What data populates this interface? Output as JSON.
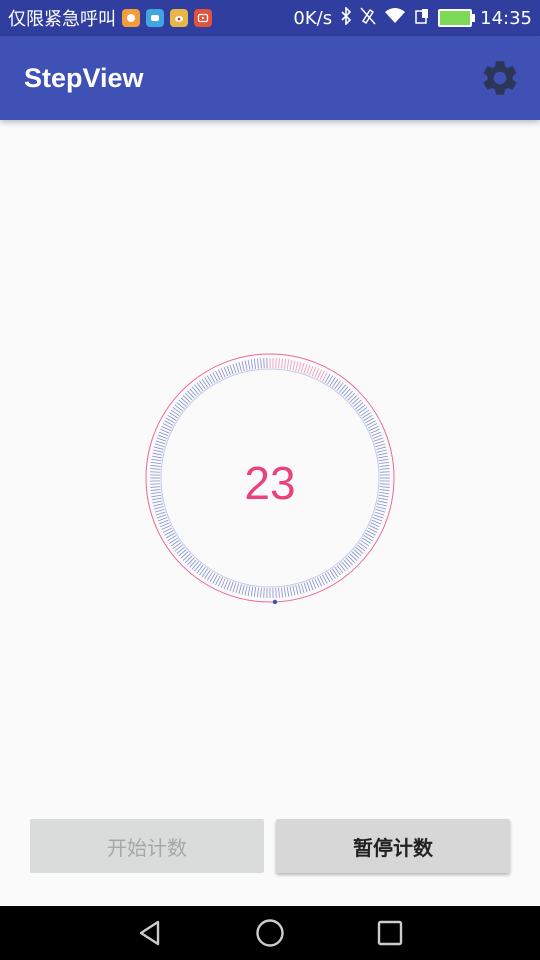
{
  "status_bar": {
    "carrier": "仅限紧急呼叫",
    "net_speed": "0K/s",
    "time": "14:35",
    "notif_icons": [
      {
        "name": "app-icon-1",
        "color": "#F39C3C"
      },
      {
        "name": "app-icon-2",
        "color": "#41A5E1"
      },
      {
        "name": "weibo-icon",
        "color": "#E8B646"
      },
      {
        "name": "video-icon",
        "color": "#E0523C"
      }
    ]
  },
  "app_bar": {
    "title": "StepView",
    "color": "#3F51B5",
    "settings_icon": "gear-icon"
  },
  "step_view": {
    "count": "23",
    "progress_fraction": 0.08,
    "accent_color": "#E9437A",
    "tick_color": "#5C6BC0"
  },
  "buttons": {
    "start_label": "开始计数",
    "pause_label": "暂停计数"
  },
  "nav": {
    "back_icon": "back-triangle-icon",
    "home_icon": "home-circle-icon",
    "recents_icon": "recents-square-icon"
  }
}
